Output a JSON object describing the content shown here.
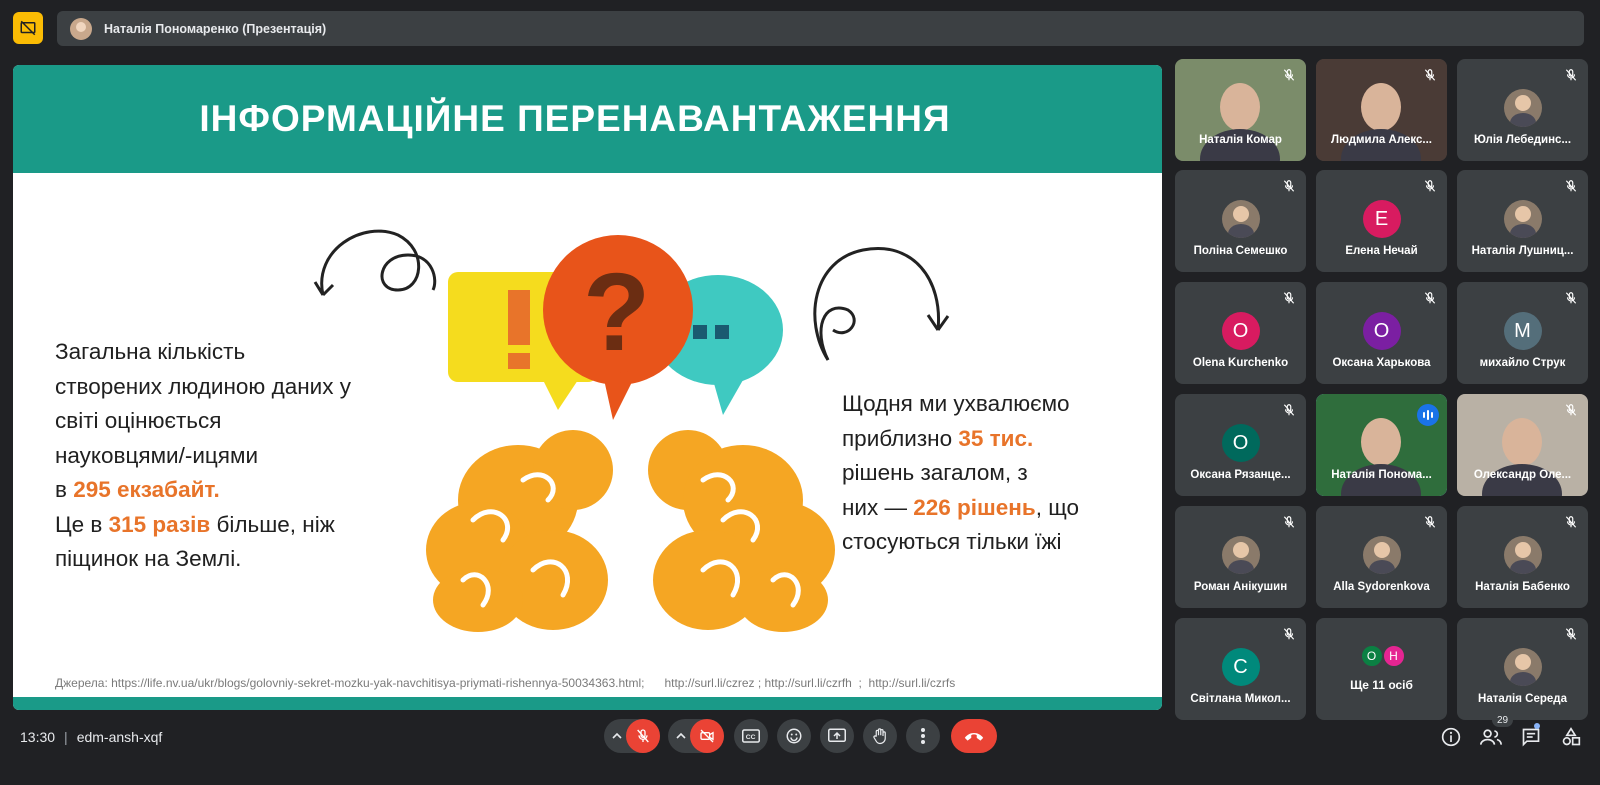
{
  "presenter": {
    "name": "Наталія Пономаренко (Презентація)"
  },
  "slide": {
    "title": "ІНФОРМАЦІЙНЕ ПЕРЕНАВАНТАЖЕННЯ",
    "left_text": {
      "line1": "Загальна кількість",
      "line2": "створених людиною даних у",
      "line3": "світі оцінюється",
      "line4": "науковцями/-ицями",
      "line5_pre": "в ",
      "line5_hl": "295 екзабайт.",
      "line6_pre": "Це в ",
      "line6_hl": "315 разів",
      "line6_post": " більше, ніж",
      "line7": "піщинок на Землі."
    },
    "right_text": {
      "line1": "Щодня ми  ухвалюємо",
      "line2_pre": "приблизно ",
      "line2_hl": "35 тис.",
      "line3": "рішень загалом, з",
      "line4_pre": "них — ",
      "line4_hl": "226  рішень",
      "line4_post": ", що",
      "line5": "стосуються тільки їжі"
    },
    "sources": "Джерела: https://life.nv.ua/ukr/blogs/golovniy-sekret-mozku-yak-navchitisya-priymati-rishennya-50034363.html;      http://surl.li/czrez ; http://surl.li/czrfh  ;  http://surl.li/czrfs"
  },
  "participants": [
    {
      "name": "Наталія Комар",
      "type": "video"
    },
    {
      "name": "Людмила Алекс...",
      "type": "video"
    },
    {
      "name": "Юлія Лебединс...",
      "type": "photo"
    },
    {
      "name": "Поліна Семешко",
      "type": "photo"
    },
    {
      "name": "Елена Нечай",
      "type": "letter",
      "letter": "Е",
      "color": "#d81b60"
    },
    {
      "name": "Наталія Лушниц...",
      "type": "photo"
    },
    {
      "name": "Olena Kurchenko",
      "type": "letter",
      "letter": "O",
      "color": "#d81b60"
    },
    {
      "name": "Оксана Харькова",
      "type": "letter",
      "letter": "O",
      "color": "#7b1fa2"
    },
    {
      "name": "михайло Струк",
      "type": "letter",
      "letter": "М",
      "color": "#546e7a"
    },
    {
      "name": "Оксана Рязанце...",
      "type": "letter",
      "letter": "O",
      "color": "#00695c"
    },
    {
      "name": "Наталія Понома...",
      "type": "video",
      "active": true
    },
    {
      "name": "Олександр Оле...",
      "type": "video"
    },
    {
      "name": "Роман Анікушин",
      "type": "photo"
    },
    {
      "name": "Alla Sydorenkova",
      "type": "photo"
    },
    {
      "name": "Наталія Бабенко",
      "type": "photo"
    },
    {
      "name": "Світлана Микол...",
      "type": "letter",
      "letter": "С",
      "color": "#00897b"
    },
    {
      "name": "Ще 11 осіб",
      "type": "more",
      "mini": [
        {
          "letter": "O",
          "color": "#0b8043"
        },
        {
          "letter": "Н",
          "color": "#e52592"
        }
      ]
    },
    {
      "name": "Наталія Середа",
      "type": "photo"
    }
  ],
  "bottom": {
    "time": "13:30",
    "separator": "|",
    "meeting_code": "edm-ansh-xqf",
    "participant_count": "29"
  },
  "colors": {
    "accent_teal": "#1a9a88",
    "highlight_orange": "#e8742a",
    "danger_red": "#ea4335",
    "tile_bg": "#3c4043",
    "bg": "#202124"
  }
}
